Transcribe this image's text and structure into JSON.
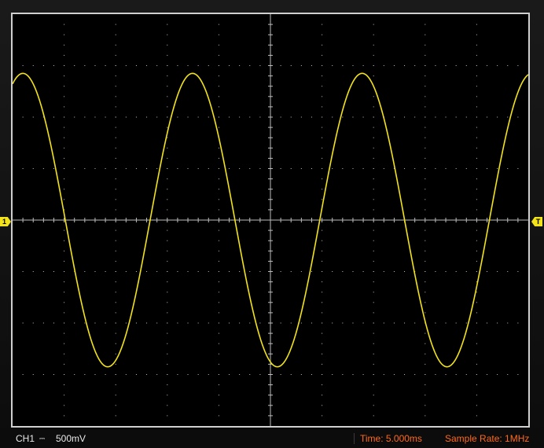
{
  "window": {
    "trace_color": "#f2e21a",
    "grid_color": "#bdbdbd",
    "screen_bg": "#000000"
  },
  "markers": {
    "channel_marker": "1",
    "trigger_marker": "T"
  },
  "status_bar": {
    "channel_label": "CH1",
    "coupling_symbol": "⎓",
    "volts_per_div": "500mV",
    "timebase": "Time: 5.000ms",
    "sample_rate": "Sample Rate: 1MHz",
    "info_color": "#ff6a1a"
  },
  "chart_data": {
    "type": "line",
    "divisions": {
      "horizontal": 10,
      "vertical": 8
    },
    "units": {
      "x": "div",
      "y": "div"
    },
    "series": [
      {
        "waveform": "sine",
        "amplitude": 2.85,
        "offset": 0,
        "cycles_on_screen": 3.04,
        "peaks_x": [
          0.2,
          3.5,
          6.8
        ],
        "troughs_x": [
          1.9,
          5.2,
          8.5
        ]
      }
    ],
    "xlim": [
      0,
      10
    ],
    "ylim": [
      -4,
      4
    ]
  }
}
